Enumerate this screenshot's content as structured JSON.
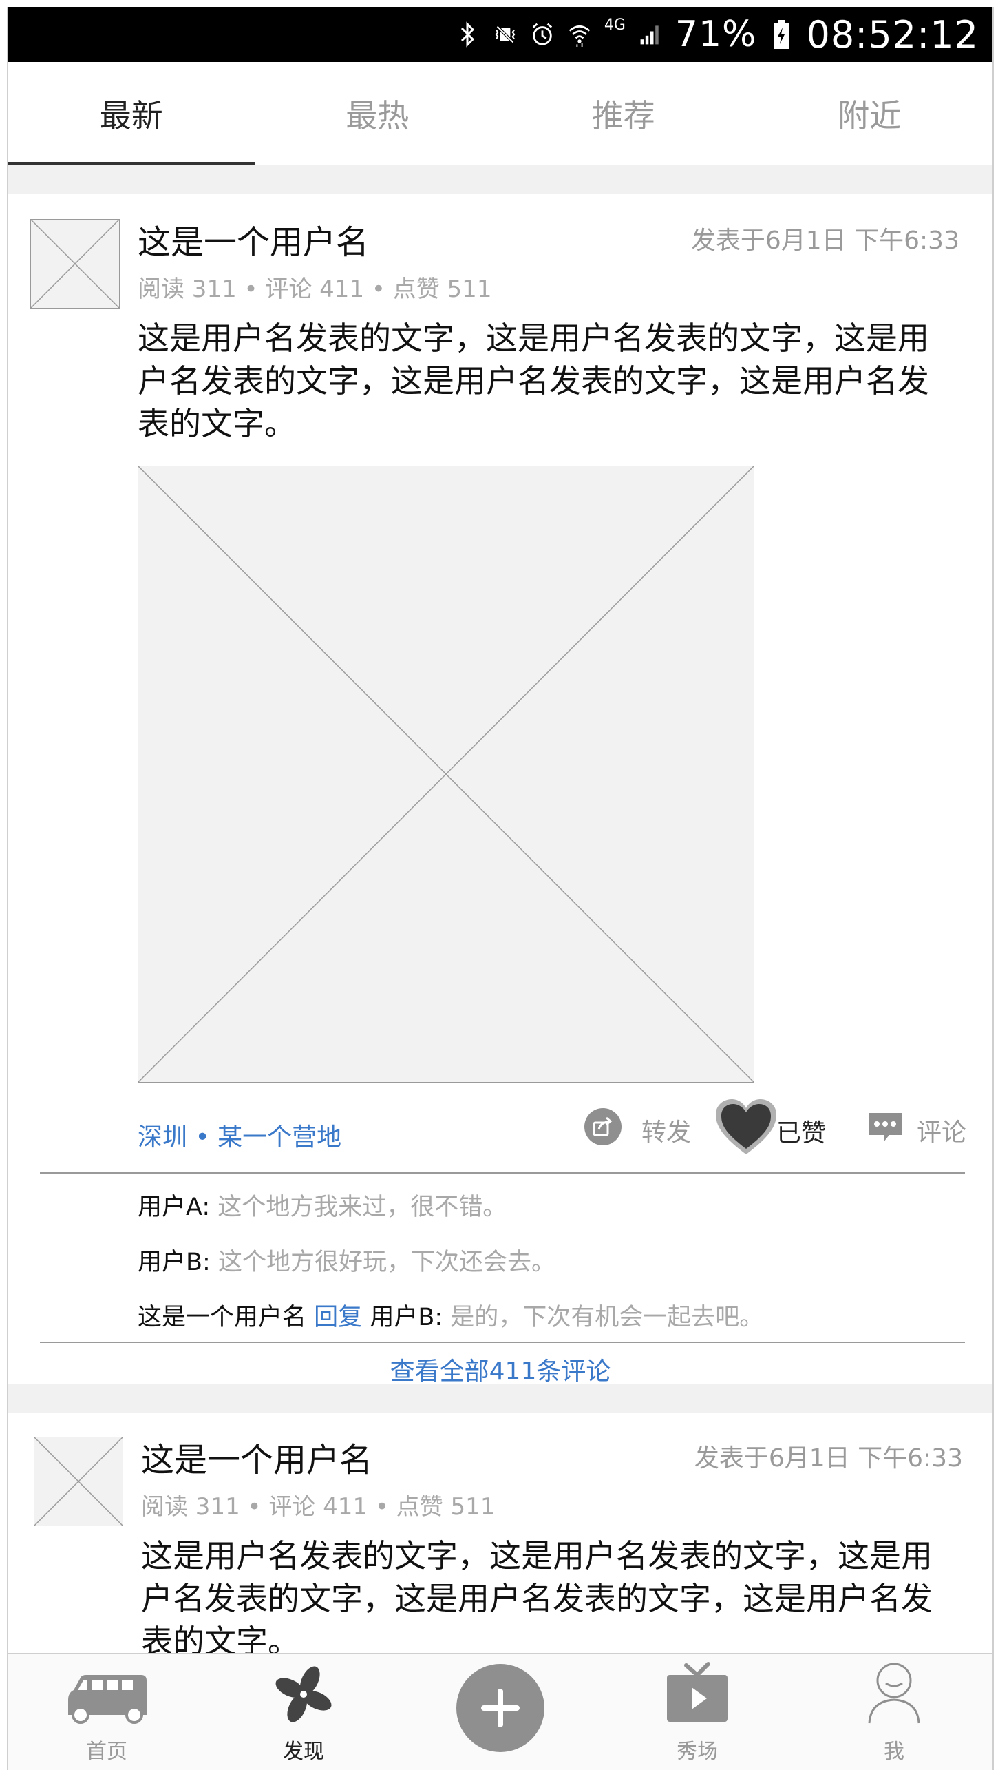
{
  "status_bar": {
    "battery": "71%",
    "network": "4G",
    "time": "08:52:12"
  },
  "tabs": [
    {
      "label": "最新",
      "active": true
    },
    {
      "label": "最热",
      "active": false
    },
    {
      "label": "推荐",
      "active": false
    },
    {
      "label": "附近",
      "active": false
    }
  ],
  "posts": [
    {
      "username": "这是一个用户名",
      "time": "发表于6月1日 下午6:33",
      "stats": "阅读 311 • 评论 411 • 点赞 511",
      "text_lines": [
        "这是用户名发表的文字，这是用户名发表的文字，这是用",
        "户名发表的文字，这是用户名发表的文字，这是用户名发",
        "表的文字。"
      ],
      "location": "深圳 • 某一个营地",
      "actions": {
        "share": "转发",
        "like": "已赞",
        "comment": "评论"
      },
      "comments": [
        {
          "user": "用户A:",
          "text": "这个地方我来过，很不错。"
        },
        {
          "user": "用户B:",
          "text": "这个地方很好玩，下次还会去。"
        },
        {
          "user": "这是一个用户名",
          "reply_word": "回复",
          "reply_to": "用户B:",
          "text": "是的，下次有机会一起去吧。"
        }
      ],
      "view_all": "查看全部411条评论"
    },
    {
      "username": "这是一个用户名",
      "time": "发表于6月1日 下午6:33",
      "stats": "阅读 311 • 评论 411 • 点赞 511",
      "text_lines": [
        "这是用户名发表的文字，这是用户名发表的文字，这是用",
        "户名发表的文字，这是用户名发表的文字，这是用户名发",
        "表的文字。"
      ]
    }
  ],
  "bottom_nav": [
    {
      "label": "首页",
      "icon": "camper-van-icon"
    },
    {
      "label": "发现",
      "icon": "pinwheel-icon",
      "active": true
    },
    {
      "label": "",
      "icon": "plus-icon"
    },
    {
      "label": "秀场",
      "icon": "tv-play-icon"
    },
    {
      "label": "我",
      "icon": "person-icon"
    }
  ]
}
